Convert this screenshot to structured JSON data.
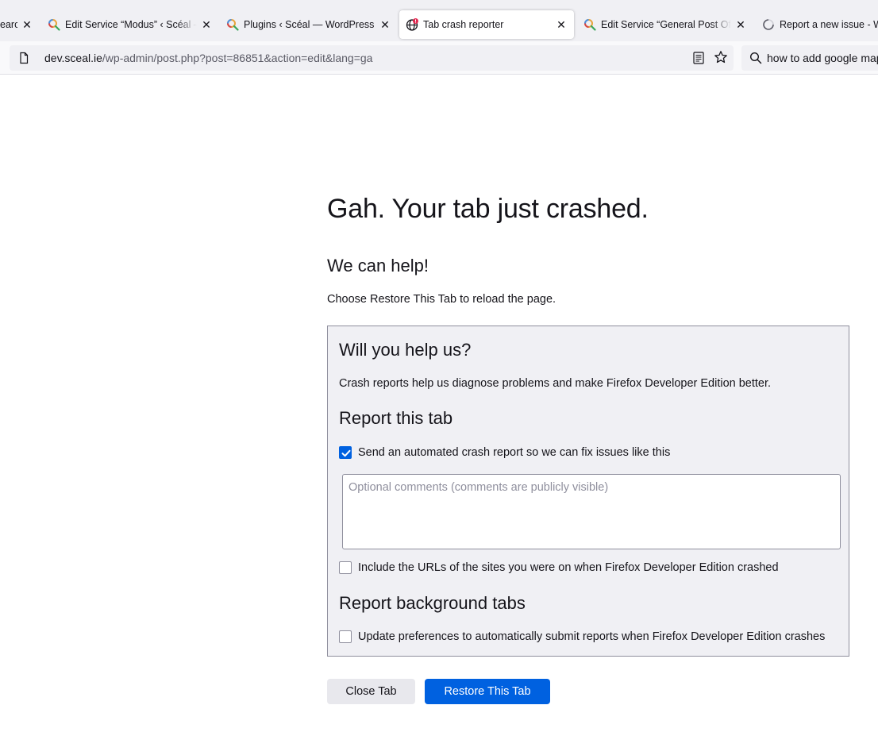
{
  "tabs": [
    {
      "title": "earch",
      "icon": "search-tab-icon"
    },
    {
      "title": "Edit Service “Modus” ‹ Scéal — W",
      "icon": "search-tab-icon"
    },
    {
      "title": "Plugins ‹ Scéal — WordPress",
      "icon": "search-tab-icon"
    },
    {
      "title": "Tab crash reporter",
      "icon": "globe-alert-icon"
    },
    {
      "title": "Edit Service “General Post Office",
      "icon": "search-tab-icon"
    },
    {
      "title": "Report a new issue - Wh",
      "icon": "loading-icon"
    }
  ],
  "urlbar": {
    "host": "dev.sceal.ie",
    "path": "/wp-admin/post.php?post=86851&action=edit&lang=ga"
  },
  "search": {
    "query": "how to add google map"
  },
  "page": {
    "heading": "Gah. Your tab just crashed.",
    "help_heading": "We can help!",
    "instructions": "Choose Restore This Tab to reload the page.",
    "panel": {
      "title": "Will you help us?",
      "description": "Crash reports help us diagnose problems and make Firefox Developer Edition better.",
      "report_tab_heading": "Report this tab",
      "send_report_label": "Send an automated crash report so we can fix issues like this",
      "send_report_checked": true,
      "comments_placeholder": "Optional comments (comments are publicly visible)",
      "include_urls_label": "Include the URLs of the sites you were on when Firefox Developer Edition crashed",
      "include_urls_checked": false,
      "background_heading": "Report background tabs",
      "auto_submit_label": "Update preferences to automatically submit reports when Firefox Developer Edition crashes",
      "auto_submit_checked": false
    },
    "close_tab_label": "Close Tab",
    "restore_tab_label": "Restore This Tab"
  },
  "colors": {
    "accent": "#0061e0",
    "tab_strip": "#f0f0f4",
    "panel_bg": "#f0f0f4",
    "alert": "#e22850"
  }
}
